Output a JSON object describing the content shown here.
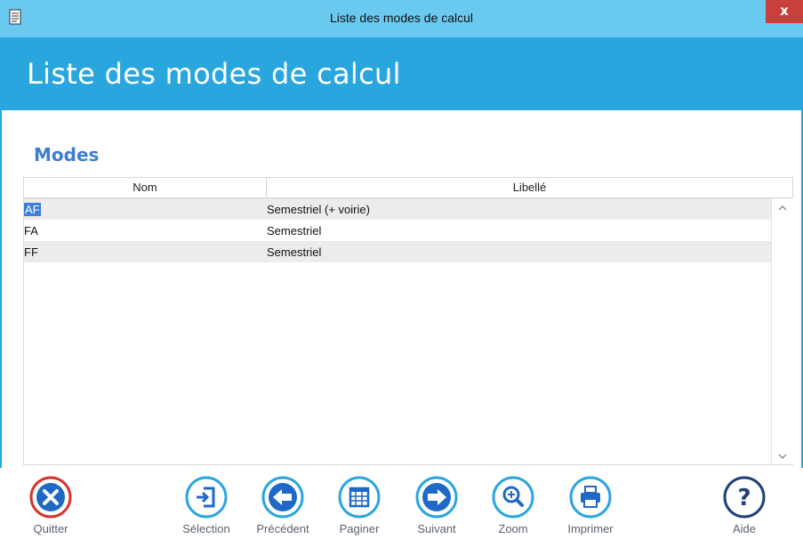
{
  "window": {
    "title": "Liste des modes de calcul",
    "close_label": "x"
  },
  "header": {
    "title": "Liste des modes de calcul"
  },
  "section": {
    "title": "Modes"
  },
  "grid": {
    "columns": [
      "Nom",
      "Libellé"
    ],
    "rows": [
      {
        "nom": "AF",
        "libelle": "Semestriel (+ voirie)"
      },
      {
        "nom": "FA",
        "libelle": "Semestriel"
      },
      {
        "nom": "FF",
        "libelle": "Semestriel"
      }
    ]
  },
  "toolbar": {
    "quitter": "Quitter",
    "selection": "Sélection",
    "precedent": "Précédent",
    "paginer": "Paginer",
    "suivant": "Suivant",
    "zoom": "Zoom",
    "imprimer": "Imprimer",
    "aide": "Aide"
  },
  "colors": {
    "accent": "#2aa6de",
    "titlebar": "#6ac9ee",
    "section_title": "#3d7dd1",
    "close": "#c9403a",
    "icon_blue": "#1f69c6",
    "icon_red": "#d9322c"
  }
}
